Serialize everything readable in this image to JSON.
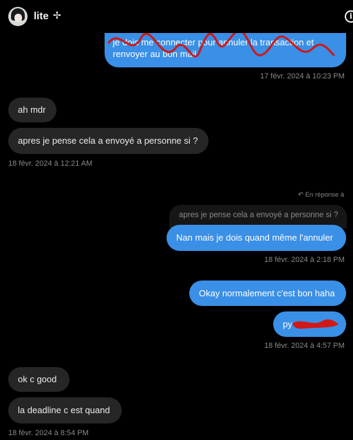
{
  "header": {
    "username": "lite",
    "badge_icon": "cross-icon",
    "info_icon": "info-icon"
  },
  "messages": {
    "first_out_text": "le dois me connecter pour annuler la transaction et renvoyer au bon mail",
    "first_out_line1": "je dois me connecter pour annuler la transaction et",
    "first_out_line2": "renvoyer au bon mail",
    "ts1": "17 févr. 2024 à 10:23 PM",
    "in1": "ah mdr",
    "in2": "apres je pense cela a envoyé a personne si ?",
    "ts2": "18 févr. 2024 à 12:21 AM",
    "reply_label": "En réponse à",
    "reply_preview": "apres je pense cela a envoyé a personne si ?",
    "out2": "Nan mais je dois quand même l'annuler",
    "ts3": "18 févr. 2024 à 2:18 PM",
    "out3": "Okay normalement c'est bon haha",
    "out4": "py",
    "ts4": "18 févr. 2024 à 4:57 PM",
    "in3": "ok c good",
    "in4": "la deadline c est quand",
    "ts5": "18 févr. 2024 à 8:54 PM"
  },
  "colors": {
    "outgoing_bubble": "#3a8fe6",
    "incoming_bubble": "#262626",
    "redaction": "#d01818"
  }
}
